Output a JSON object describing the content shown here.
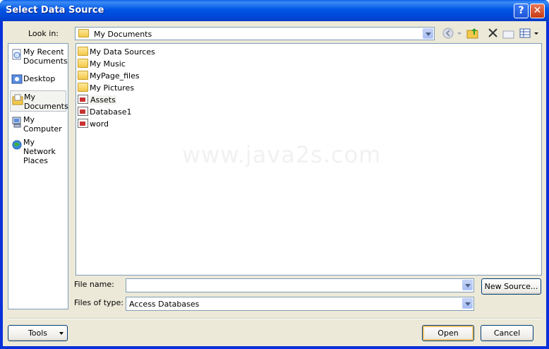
{
  "window": {
    "title": "Select Data Source"
  },
  "lookin": {
    "label": "Look in:",
    "value": "My Documents"
  },
  "places": [
    {
      "name": "recent",
      "label": "My Recent Documents",
      "icon": "recent-documents-icon"
    },
    {
      "name": "desktop",
      "label": "Desktop",
      "icon": "desktop-icon"
    },
    {
      "name": "documents",
      "label": "My Documents",
      "icon": "my-documents-icon"
    },
    {
      "name": "computer",
      "label": "My Computer",
      "icon": "my-computer-icon"
    },
    {
      "name": "network",
      "label": "My Network Places",
      "icon": "network-places-icon"
    }
  ],
  "files": [
    {
      "name": "My Data Sources",
      "type": "folder"
    },
    {
      "name": "My Music",
      "type": "folder"
    },
    {
      "name": "MyPage_files",
      "type": "folder"
    },
    {
      "name": "My Pictures",
      "type": "folder"
    },
    {
      "name": "Assets",
      "type": "access-db"
    },
    {
      "name": "Database1",
      "type": "access-db"
    },
    {
      "name": "word",
      "type": "access-db"
    }
  ],
  "watermark": "www.java2s.com",
  "filename": {
    "label": "File name:",
    "value": ""
  },
  "filetype": {
    "label": "Files of type:",
    "value": "Access Databases"
  },
  "buttons": {
    "new_source": "New Source...",
    "tools": "Tools",
    "open": "Open",
    "cancel": "Cancel"
  }
}
